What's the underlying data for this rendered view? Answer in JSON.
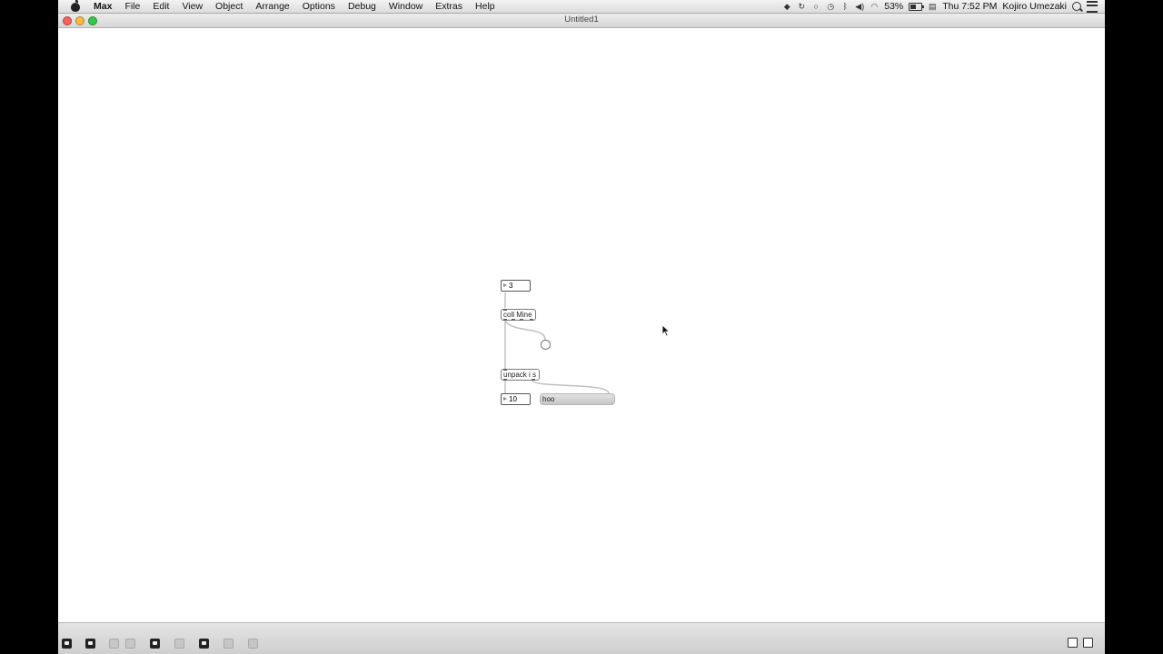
{
  "menubar": {
    "app_name": "Max",
    "items": [
      "File",
      "Edit",
      "View",
      "Object",
      "Arrange",
      "Options",
      "Debug",
      "Window",
      "Extras",
      "Help"
    ],
    "status": {
      "battery_percent": "53%",
      "clock": "Thu 7:52 PM",
      "user": "Kojiro Umezaki"
    }
  },
  "window": {
    "title": "Untitled1"
  },
  "patch": {
    "number_top": "3",
    "coll_label": "coll Mine",
    "unpack_label": "unpack i s",
    "number_bottom": "10",
    "message_text": "hoo"
  },
  "colors": {
    "patch_cord": "#c0c0c0",
    "menubar_bg": "#e8e8e8",
    "close": "#fc605b",
    "minimize": "#fdbc40",
    "zoom": "#34c84a"
  }
}
